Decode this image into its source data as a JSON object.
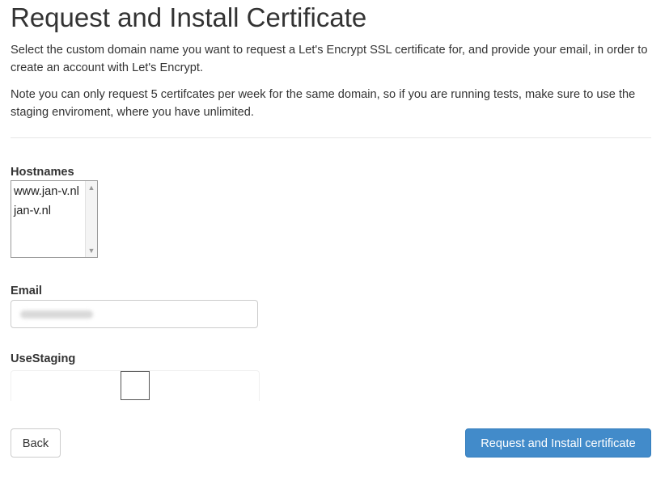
{
  "page": {
    "title": "Request and Install Certificate",
    "intro": "Select the custom domain name you want to request a Let's Encrypt SSL certificate for, and provide your email, in order to create an account with Let's Encrypt.",
    "note": "Note you can only request 5 certifcates per week for the same domain, so if you are running tests, make sure to use the staging enviroment, where you have unlimited."
  },
  "form": {
    "hostnames": {
      "label": "Hostnames",
      "options": [
        "www.jan-v.nl",
        "jan-v.nl"
      ]
    },
    "email": {
      "label": "Email",
      "value": "",
      "obscured": true
    },
    "use_staging": {
      "label": "UseStaging",
      "checked": false
    }
  },
  "actions": {
    "back_label": "Back",
    "submit_label": "Request and Install certificate"
  },
  "colors": {
    "primary": "#428bca",
    "text": "#333333",
    "border": "#cccccc"
  },
  "icons": {
    "scroll_up": "chevron-up-icon",
    "scroll_down": "chevron-down-icon"
  }
}
